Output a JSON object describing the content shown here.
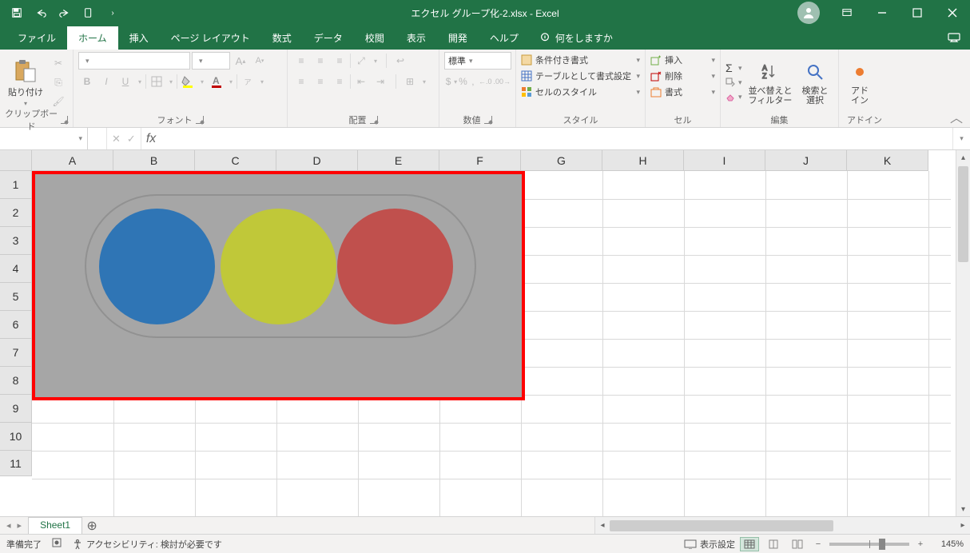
{
  "title": "エクセル グループ化-2.xlsx  -  Excel",
  "qat_customize": "›",
  "tabs": {
    "file": "ファイル",
    "home": "ホーム",
    "insert": "挿入",
    "page_layout": "ページ レイアウト",
    "formulas": "数式",
    "data": "データ",
    "review": "校閲",
    "view": "表示",
    "developer": "開発",
    "help": "ヘルプ",
    "tellme": "何をしますか"
  },
  "groups": {
    "clipboard": {
      "label": "クリップボード",
      "paste": "貼り付け"
    },
    "font": {
      "label": "フォント",
      "font_name": "",
      "font_size": "",
      "bold": "B",
      "italic": "I",
      "underline": "U"
    },
    "alignment": {
      "label": "配置"
    },
    "number": {
      "label": "数値",
      "format": "標準",
      "dec1": ".0",
      "dec2": ".00"
    },
    "styles": {
      "label": "スタイル",
      "cond": "条件付き書式",
      "table": "テーブルとして書式設定",
      "cell": "セルのスタイル"
    },
    "cells": {
      "label": "セル",
      "insert": "挿入",
      "delete": "削除",
      "format": "書式"
    },
    "editing": {
      "label": "編集",
      "sort": "並べ替えと\nフィルター",
      "find": "検索と\n選択"
    },
    "addins": {
      "label": "アドイン",
      "addin": "アド\nイン"
    }
  },
  "formula_bar": {
    "name": "",
    "cancel": "✕",
    "enter": "✓",
    "fx": "fx"
  },
  "columns": [
    "A",
    "B",
    "C",
    "D",
    "E",
    "F",
    "G",
    "H",
    "I",
    "J",
    "K"
  ],
  "rows": [
    "1",
    "2",
    "3",
    "4",
    "5",
    "6",
    "7",
    "8",
    "9",
    "10",
    "11"
  ],
  "sheet_tab": "Sheet1",
  "status": {
    "ready": "準備完了",
    "accessibility": "アクセシビリティ: 検討が必要です",
    "display_settings": "表示設定",
    "zoom": "145%"
  },
  "colors": {
    "blue": "#2f75b5",
    "yellow": "#c0c839",
    "red": "#c0504d",
    "grey": "#a6a6a6",
    "highlight": "#ff0000"
  }
}
